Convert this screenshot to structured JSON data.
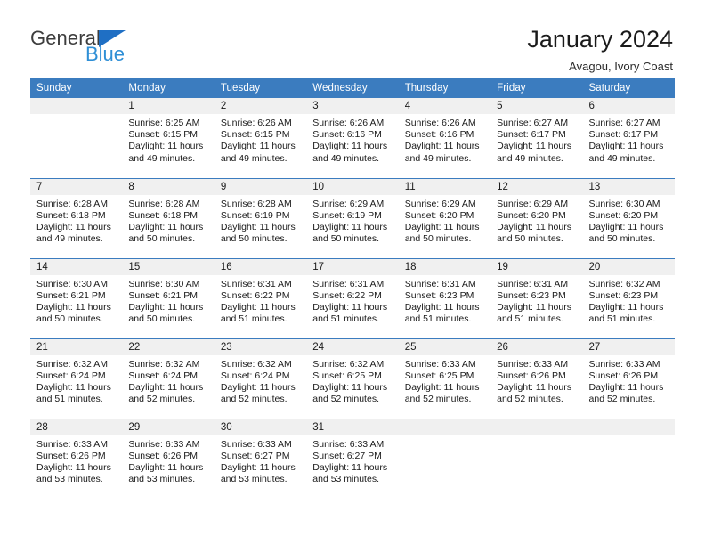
{
  "brand": {
    "name_top": "General",
    "name_bottom": "Blue",
    "triangle_color": "#1f6fc4",
    "top_color": "#3d3d3d",
    "bottom_color": "#2f8fd6"
  },
  "header": {
    "title": "January 2024",
    "subtitle": "Avagou, Ivory Coast"
  },
  "theme": {
    "header_blue": "#3b7cbf",
    "daynum_bg": "#f0f0f0",
    "text": "#1a1a1a"
  },
  "weekdays": [
    "Sunday",
    "Monday",
    "Tuesday",
    "Wednesday",
    "Thursday",
    "Friday",
    "Saturday"
  ],
  "labels": {
    "sunrise_prefix": "Sunrise:",
    "sunset_prefix": "Sunset:",
    "daylight_prefix": "Daylight:"
  },
  "weeks": [
    [
      {
        "day": "",
        "blank": true,
        "sunrise": "",
        "sunset": "",
        "daylight": ""
      },
      {
        "day": "1",
        "sunrise": "Sunrise: 6:25 AM",
        "sunset": "Sunset: 6:15 PM",
        "daylight": "Daylight: 11 hours and 49 minutes."
      },
      {
        "day": "2",
        "sunrise": "Sunrise: 6:26 AM",
        "sunset": "Sunset: 6:15 PM",
        "daylight": "Daylight: 11 hours and 49 minutes."
      },
      {
        "day": "3",
        "sunrise": "Sunrise: 6:26 AM",
        "sunset": "Sunset: 6:16 PM",
        "daylight": "Daylight: 11 hours and 49 minutes."
      },
      {
        "day": "4",
        "sunrise": "Sunrise: 6:26 AM",
        "sunset": "Sunset: 6:16 PM",
        "daylight": "Daylight: 11 hours and 49 minutes."
      },
      {
        "day": "5",
        "sunrise": "Sunrise: 6:27 AM",
        "sunset": "Sunset: 6:17 PM",
        "daylight": "Daylight: 11 hours and 49 minutes."
      },
      {
        "day": "6",
        "sunrise": "Sunrise: 6:27 AM",
        "sunset": "Sunset: 6:17 PM",
        "daylight": "Daylight: 11 hours and 49 minutes."
      }
    ],
    [
      {
        "day": "7",
        "sunrise": "Sunrise: 6:28 AM",
        "sunset": "Sunset: 6:18 PM",
        "daylight": "Daylight: 11 hours and 49 minutes."
      },
      {
        "day": "8",
        "sunrise": "Sunrise: 6:28 AM",
        "sunset": "Sunset: 6:18 PM",
        "daylight": "Daylight: 11 hours and 50 minutes."
      },
      {
        "day": "9",
        "sunrise": "Sunrise: 6:28 AM",
        "sunset": "Sunset: 6:19 PM",
        "daylight": "Daylight: 11 hours and 50 minutes."
      },
      {
        "day": "10",
        "sunrise": "Sunrise: 6:29 AM",
        "sunset": "Sunset: 6:19 PM",
        "daylight": "Daylight: 11 hours and 50 minutes."
      },
      {
        "day": "11",
        "sunrise": "Sunrise: 6:29 AM",
        "sunset": "Sunset: 6:20 PM",
        "daylight": "Daylight: 11 hours and 50 minutes."
      },
      {
        "day": "12",
        "sunrise": "Sunrise: 6:29 AM",
        "sunset": "Sunset: 6:20 PM",
        "daylight": "Daylight: 11 hours and 50 minutes."
      },
      {
        "day": "13",
        "sunrise": "Sunrise: 6:30 AM",
        "sunset": "Sunset: 6:20 PM",
        "daylight": "Daylight: 11 hours and 50 minutes."
      }
    ],
    [
      {
        "day": "14",
        "sunrise": "Sunrise: 6:30 AM",
        "sunset": "Sunset: 6:21 PM",
        "daylight": "Daylight: 11 hours and 50 minutes."
      },
      {
        "day": "15",
        "sunrise": "Sunrise: 6:30 AM",
        "sunset": "Sunset: 6:21 PM",
        "daylight": "Daylight: 11 hours and 50 minutes."
      },
      {
        "day": "16",
        "sunrise": "Sunrise: 6:31 AM",
        "sunset": "Sunset: 6:22 PM",
        "daylight": "Daylight: 11 hours and 51 minutes."
      },
      {
        "day": "17",
        "sunrise": "Sunrise: 6:31 AM",
        "sunset": "Sunset: 6:22 PM",
        "daylight": "Daylight: 11 hours and 51 minutes."
      },
      {
        "day": "18",
        "sunrise": "Sunrise: 6:31 AM",
        "sunset": "Sunset: 6:23 PM",
        "daylight": "Daylight: 11 hours and 51 minutes."
      },
      {
        "day": "19",
        "sunrise": "Sunrise: 6:31 AM",
        "sunset": "Sunset: 6:23 PM",
        "daylight": "Daylight: 11 hours and 51 minutes."
      },
      {
        "day": "20",
        "sunrise": "Sunrise: 6:32 AM",
        "sunset": "Sunset: 6:23 PM",
        "daylight": "Daylight: 11 hours and 51 minutes."
      }
    ],
    [
      {
        "day": "21",
        "sunrise": "Sunrise: 6:32 AM",
        "sunset": "Sunset: 6:24 PM",
        "daylight": "Daylight: 11 hours and 51 minutes."
      },
      {
        "day": "22",
        "sunrise": "Sunrise: 6:32 AM",
        "sunset": "Sunset: 6:24 PM",
        "daylight": "Daylight: 11 hours and 52 minutes."
      },
      {
        "day": "23",
        "sunrise": "Sunrise: 6:32 AM",
        "sunset": "Sunset: 6:24 PM",
        "daylight": "Daylight: 11 hours and 52 minutes."
      },
      {
        "day": "24",
        "sunrise": "Sunrise: 6:32 AM",
        "sunset": "Sunset: 6:25 PM",
        "daylight": "Daylight: 11 hours and 52 minutes."
      },
      {
        "day": "25",
        "sunrise": "Sunrise: 6:33 AM",
        "sunset": "Sunset: 6:25 PM",
        "daylight": "Daylight: 11 hours and 52 minutes."
      },
      {
        "day": "26",
        "sunrise": "Sunrise: 6:33 AM",
        "sunset": "Sunset: 6:26 PM",
        "daylight": "Daylight: 11 hours and 52 minutes."
      },
      {
        "day": "27",
        "sunrise": "Sunrise: 6:33 AM",
        "sunset": "Sunset: 6:26 PM",
        "daylight": "Daylight: 11 hours and 52 minutes."
      }
    ],
    [
      {
        "day": "28",
        "sunrise": "Sunrise: 6:33 AM",
        "sunset": "Sunset: 6:26 PM",
        "daylight": "Daylight: 11 hours and 53 minutes."
      },
      {
        "day": "29",
        "sunrise": "Sunrise: 6:33 AM",
        "sunset": "Sunset: 6:26 PM",
        "daylight": "Daylight: 11 hours and 53 minutes."
      },
      {
        "day": "30",
        "sunrise": "Sunrise: 6:33 AM",
        "sunset": "Sunset: 6:27 PM",
        "daylight": "Daylight: 11 hours and 53 minutes."
      },
      {
        "day": "31",
        "sunrise": "Sunrise: 6:33 AM",
        "sunset": "Sunset: 6:27 PM",
        "daylight": "Daylight: 11 hours and 53 minutes."
      },
      {
        "day": "",
        "blank": true,
        "sunrise": "",
        "sunset": "",
        "daylight": ""
      },
      {
        "day": "",
        "blank": true,
        "sunrise": "",
        "sunset": "",
        "daylight": ""
      },
      {
        "day": "",
        "blank": true,
        "sunrise": "",
        "sunset": "",
        "daylight": ""
      }
    ]
  ]
}
